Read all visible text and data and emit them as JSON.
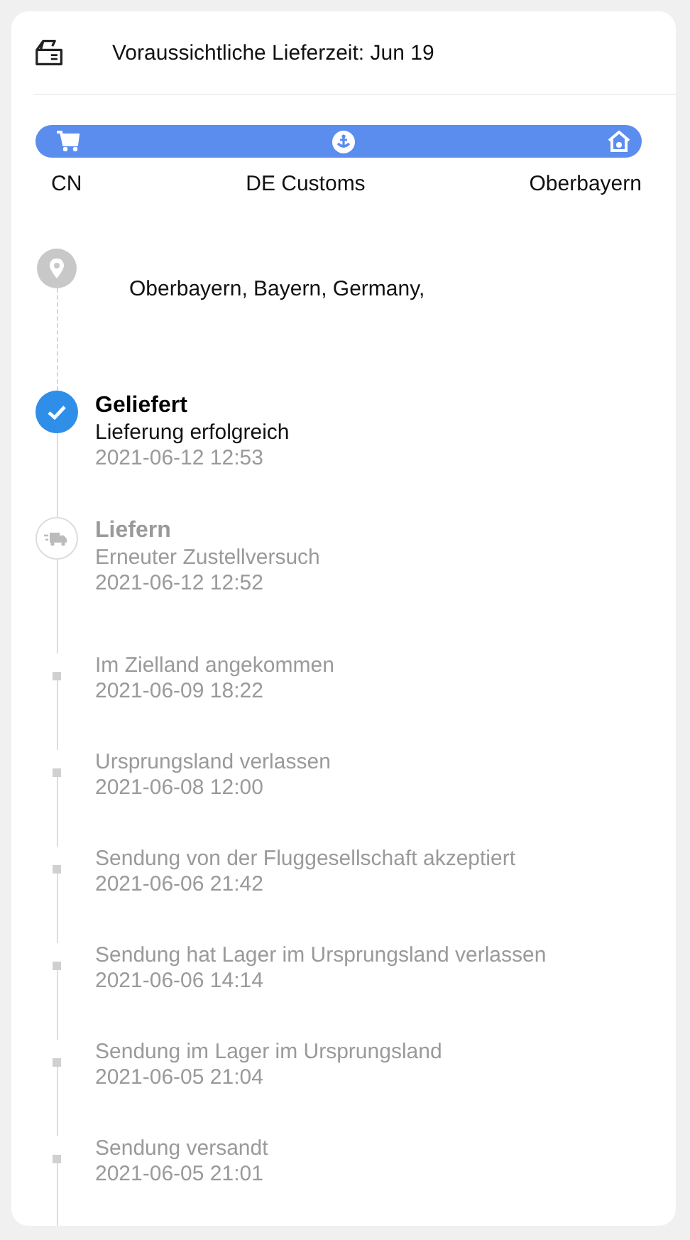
{
  "header": {
    "eta": "Voraussichtliche Lieferzeit: Jun 19"
  },
  "route": {
    "level": 1,
    "stops": [
      {
        "label": "CN",
        "kind": "origin"
      },
      {
        "label": "DE Customs",
        "kind": "customs"
      },
      {
        "label": "Oberbayern",
        "kind": "destination"
      }
    ]
  },
  "address": {
    "line": "Oberbayern,  Bayern,  Germany,"
  },
  "events": [
    {
      "kind": "delivered",
      "title": "Geliefert",
      "subtitle": "Lieferung erfolgreich",
      "time": "2021-06-12 12:53"
    },
    {
      "kind": "delivering",
      "title": "Liefern",
      "subtitle": "Erneuter Zustellversuch",
      "time": "2021-06-12 12:52"
    },
    {
      "kind": "step",
      "title": "Im Zielland angekommen",
      "time": "2021-06-09 18:22"
    },
    {
      "kind": "step",
      "title": "Ursprungsland verlassen",
      "time": "2021-06-08 12:00"
    },
    {
      "kind": "step",
      "title": "Sendung von der Fluggesellschaft akzeptiert",
      "time": "2021-06-06 21:42"
    },
    {
      "kind": "step",
      "title": "Sendung hat Lager im Ursprungsland verlassen",
      "time": "2021-06-06 14:14"
    },
    {
      "kind": "step",
      "title": "Sendung im Lager im Ursprungsland",
      "time": "2021-06-05 21:04"
    },
    {
      "kind": "step",
      "title": "Sendung versandt",
      "time": "2021-06-05 21:01"
    }
  ]
}
